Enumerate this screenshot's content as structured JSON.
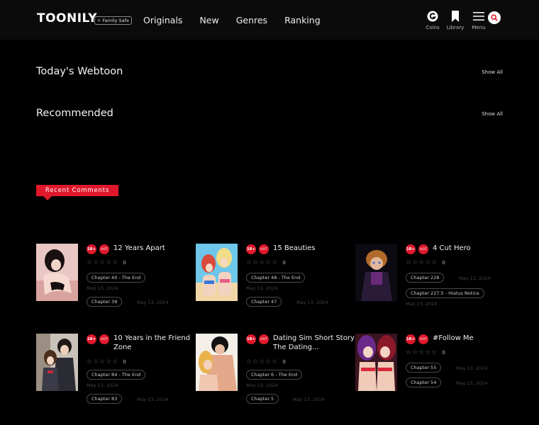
{
  "header": {
    "logo_a": "TOO",
    "logo_b": "NILY",
    "family_safe": "+ Family Safe",
    "nav": [
      "Originals",
      "New",
      "Genres",
      "Ranking"
    ],
    "coins_label": "Coins",
    "library_label": "Library",
    "menu_label": "Menu"
  },
  "sections": {
    "today": {
      "title": "Today's Webtoon",
      "show_all": "Show All"
    },
    "recommended": {
      "title": "Recommended",
      "show_all": "Show All"
    },
    "recent_comments": "Recent Comments"
  },
  "badges": {
    "adult": "18+",
    "hot": "HOT"
  },
  "stars": "☆☆☆☆☆",
  "comics": [
    {
      "title": "12 Years Apart",
      "rating_count": "0",
      "chapters": [
        {
          "label": "Chapter 40 - The End",
          "date": "May 13, 2024"
        },
        {
          "label": "Chapter 39",
          "date": "May 13, 2024"
        }
      ]
    },
    {
      "title": "15 Beauties",
      "rating_count": "0",
      "chapters": [
        {
          "label": "Chapter 48 - The End",
          "date": "May 13, 2024"
        },
        {
          "label": "Chapter 47",
          "date": "May 13, 2024"
        }
      ]
    },
    {
      "title": "4 Cut Hero",
      "rating_count": "0",
      "chapters": [
        {
          "label": "Chapter 228",
          "date": "May 13, 2024"
        },
        {
          "label": "Chapter 227.5 - Hiatus Notice",
          "date": "May 13, 2024"
        }
      ]
    },
    {
      "title": "10 Years in the Friend Zone",
      "rating_count": "0",
      "chapters": [
        {
          "label": "Chapter 84 - The End",
          "date": "May 13, 2024"
        },
        {
          "label": "Chapter 83",
          "date": "May 13, 2024"
        }
      ]
    },
    {
      "title": "Dating Sim Short Story The Dating...",
      "rating_count": "0",
      "chapters": [
        {
          "label": "Chapter 6 - The End",
          "date": "May 13, 2024"
        },
        {
          "label": "Chapter 5",
          "date": "May 13, 2024"
        }
      ]
    },
    {
      "title": "#Follow Me",
      "rating_count": "0",
      "chapters": [
        {
          "label": "Chapter 55",
          "date": "May 13, 2024"
        },
        {
          "label": "Chapter 54",
          "date": "May 13, 2024"
        }
      ]
    }
  ],
  "colors": {
    "accent": "#e0182b",
    "background": "#000000",
    "header": "#0b0b0b"
  }
}
